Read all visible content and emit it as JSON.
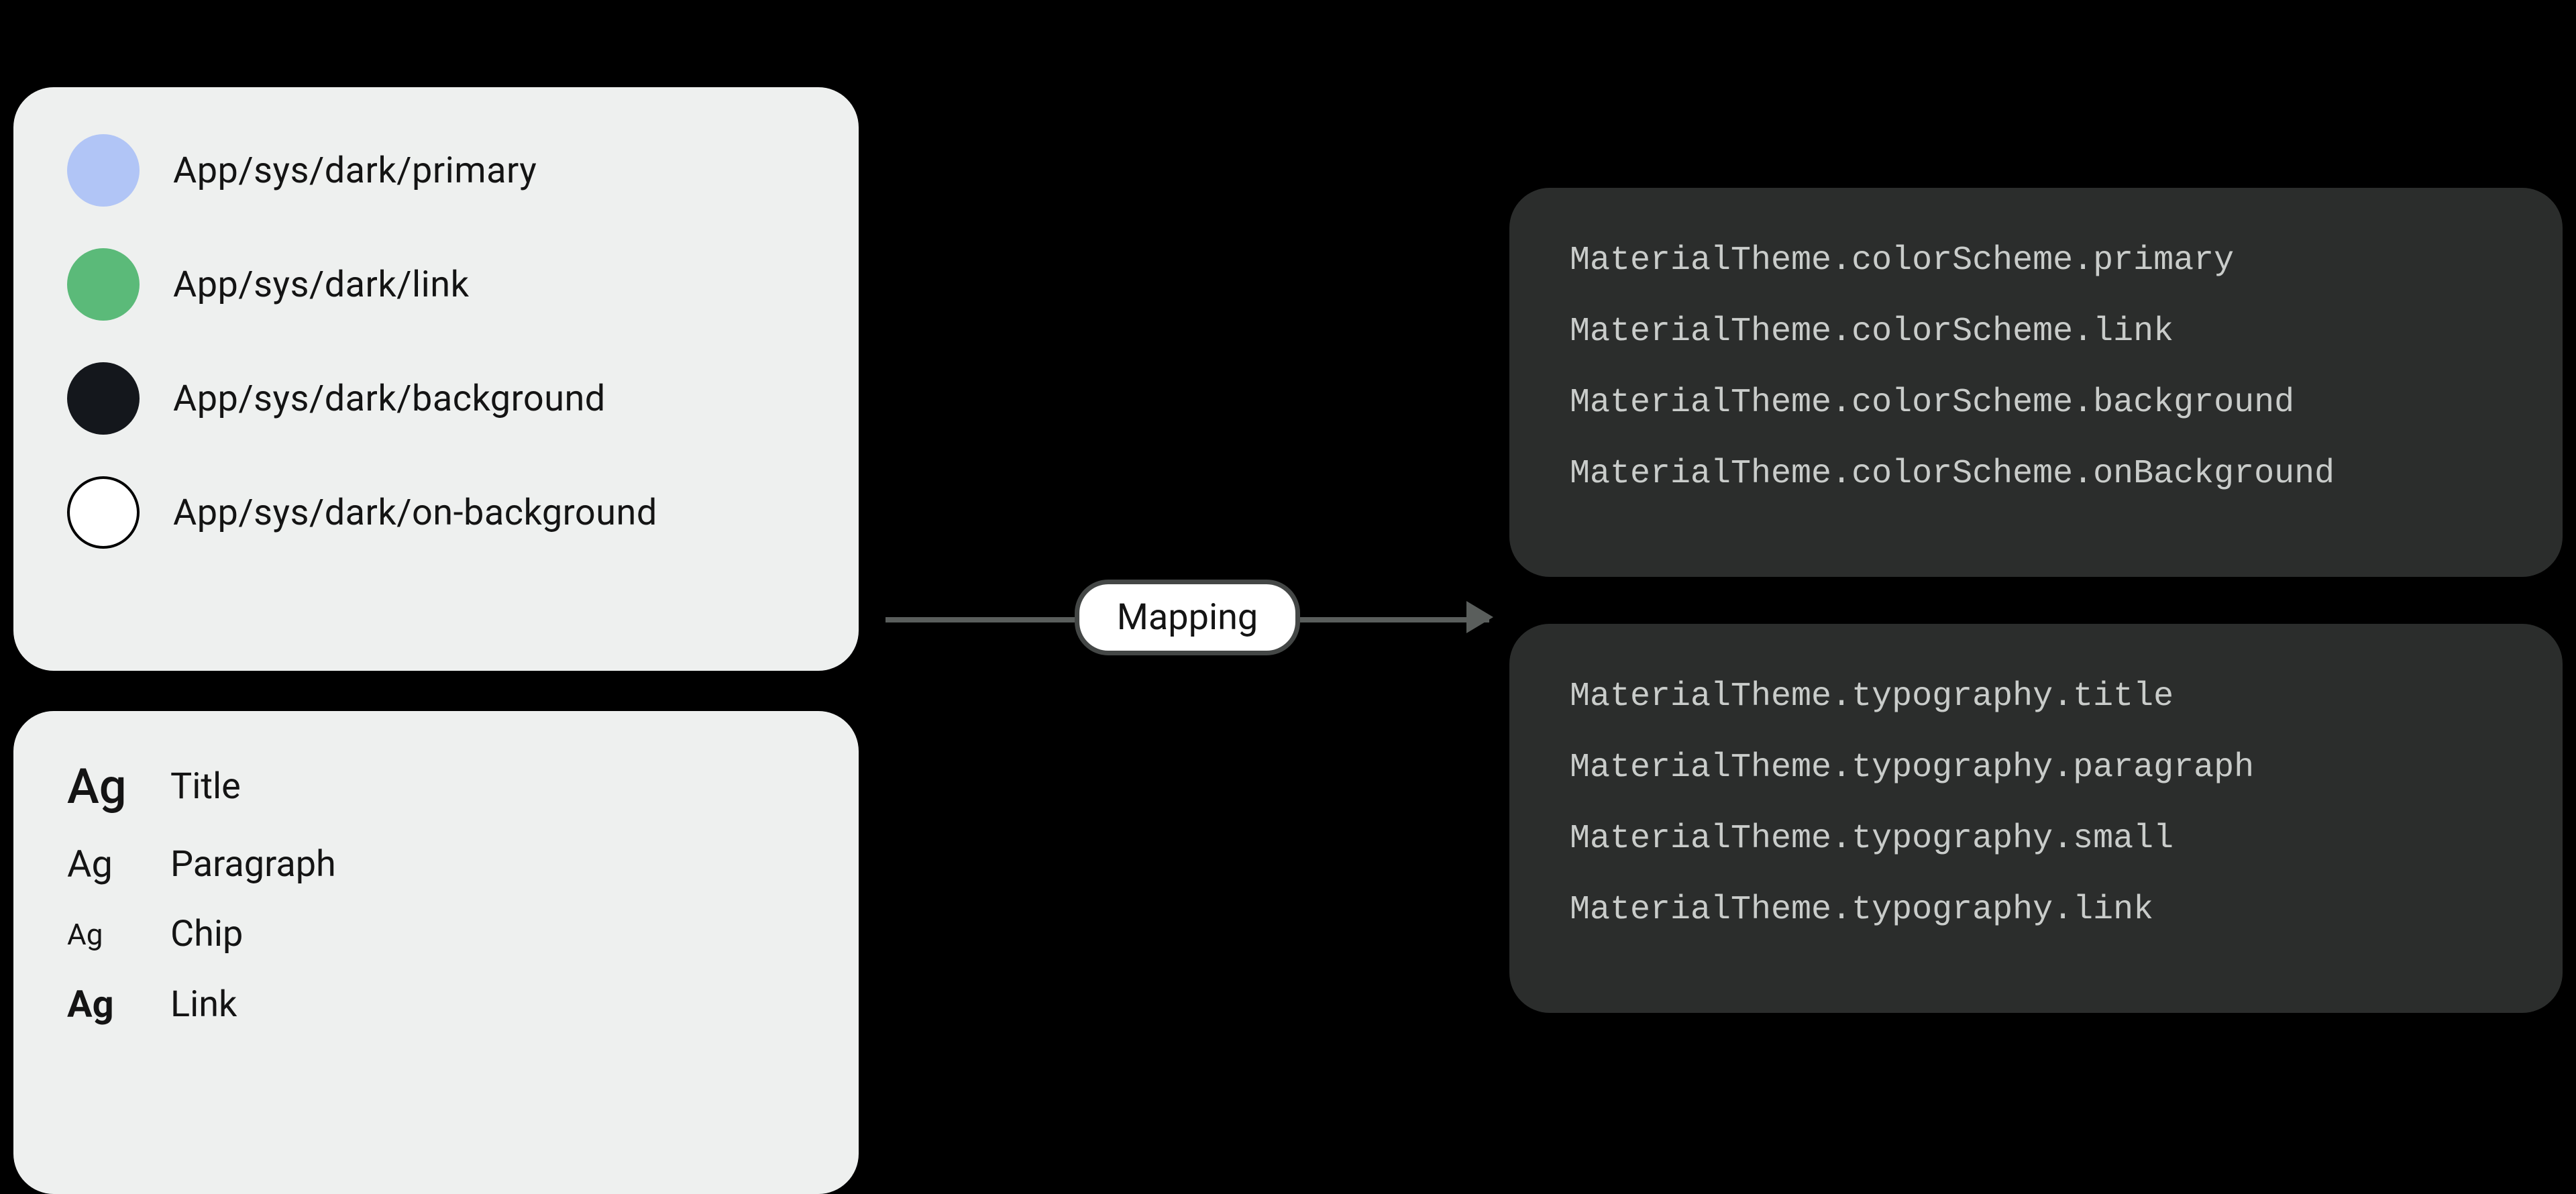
{
  "tokens": {
    "colors": [
      {
        "name": "App/sys/dark/primary",
        "swatch_class": "swatch-primary"
      },
      {
        "name": "App/sys/dark/link",
        "swatch_class": "swatch-link"
      },
      {
        "name": "App/sys/dark/background",
        "swatch_class": "swatch-bg"
      },
      {
        "name": "App/sys/dark/on-background",
        "swatch_class": "swatch-onbg"
      }
    ],
    "typography": [
      {
        "sample": "Ag",
        "label": "Title",
        "style_class": "ag-title"
      },
      {
        "sample": "Ag",
        "label": "Paragraph",
        "style_class": "ag-para"
      },
      {
        "sample": "Ag",
        "label": "Chip",
        "style_class": "ag-chip"
      },
      {
        "sample": "Ag",
        "label": "Link",
        "style_class": "ag-link"
      }
    ]
  },
  "mapping_label": "Mapping",
  "code": {
    "color_scheme": [
      "MaterialTheme.colorScheme.primary",
      "MaterialTheme.colorScheme.link",
      "MaterialTheme.colorScheme.background",
      "MaterialTheme.colorScheme.onBackground"
    ],
    "typography": [
      "MaterialTheme.typography.title",
      "MaterialTheme.typography.paragraph",
      "MaterialTheme.typography.small",
      "MaterialTheme.typography.link"
    ]
  }
}
